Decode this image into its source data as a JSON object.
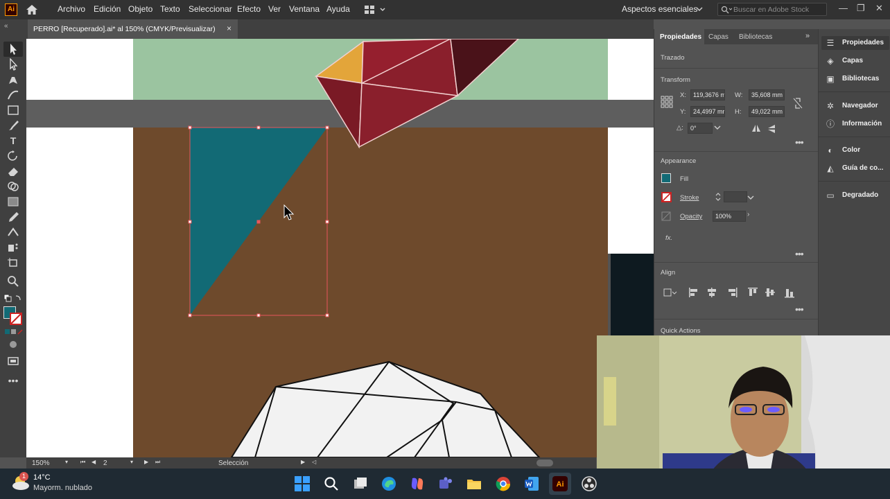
{
  "app": {
    "logo": "Ai",
    "menu": [
      "Archivo",
      "Edición",
      "Objeto",
      "Texto",
      "Seleccionar",
      "Efecto",
      "Ver",
      "Ventana",
      "Ayuda"
    ],
    "workspace": "Aspectos esenciales",
    "search_placeholder": "Buscar en Adobe Stock",
    "icons": [
      "home-icon",
      "arrange-documents-icon",
      "search-icon",
      "minimize-icon",
      "maximize-icon",
      "close-icon"
    ]
  },
  "document": {
    "tab_title": "PERRO [Recuperado].ai* al 150% (CMYK/Previsualizar)",
    "close_glyph": "×"
  },
  "status": {
    "zoom": "150%",
    "artboard": "2",
    "tool": "Selección"
  },
  "panel": {
    "tabs": [
      "Propiedades",
      "Capas",
      "Bibliotecas"
    ],
    "section_trazado": "Trazado",
    "transform": {
      "title": "Transform",
      "x_label": "X:",
      "x_value": "119,3676 m",
      "y_label": "Y:",
      "y_value": "24,4997 mr",
      "w_label": "W:",
      "w_value": "35,608 mm",
      "h_label": "H:",
      "h_value": "49,022 mm",
      "angle_label": "△:",
      "angle_value": "0°"
    },
    "appearance": {
      "title": "Appearance",
      "fill_label": "Fill",
      "stroke_label": "Stroke",
      "opacity_label": "Opacity",
      "opacity_value": "100%",
      "fx_label": "fx."
    },
    "align": {
      "title": "Align"
    },
    "quick_actions": "Quick Actions",
    "more": "•••"
  },
  "dock": {
    "items": [
      {
        "label": "Propiedades",
        "icon": "properties-icon"
      },
      {
        "label": "Capas",
        "icon": "layers-icon"
      },
      {
        "label": "Bibliotecas",
        "icon": "libraries-icon"
      },
      {
        "label": "Navegador",
        "icon": "navigator-icon"
      },
      {
        "label": "Información",
        "icon": "info-icon"
      },
      {
        "label": "Color",
        "icon": "color-icon"
      },
      {
        "label": "Guía de co...",
        "icon": "color-guide-icon"
      },
      {
        "label": "Degradado",
        "icon": "gradient-icon"
      }
    ]
  },
  "taskbar": {
    "temperature": "14°C",
    "weather": "Mayorm. nublado",
    "weather_badge": "1"
  },
  "colors": {
    "selection": "#e8575b",
    "teal_fill": "#126a75",
    "canvas_brown": "#6e4a2c",
    "green_bg": "#9bc4a0",
    "red_poly": "#8a1f2c",
    "orange_poly": "#e3a53a",
    "dark_poly": "#4a1219"
  }
}
